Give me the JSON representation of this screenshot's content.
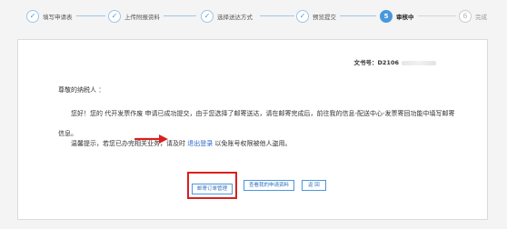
{
  "steps": [
    {
      "num": "✓",
      "label": "填写申请表",
      "state": "done"
    },
    {
      "num": "✓",
      "label": "上传附报资料",
      "state": "done"
    },
    {
      "num": "✓",
      "label": "选择送达方式",
      "state": "done"
    },
    {
      "num": "✓",
      "label": "预览提交",
      "state": "done"
    },
    {
      "num": "5",
      "label": "审核中",
      "state": "active"
    },
    {
      "num": "6",
      "label": "完成",
      "state": "future"
    }
  ],
  "doc_number": {
    "label": "文书号：D2106"
  },
  "message": {
    "greeting": "尊敬的纳税人 ：",
    "body": "您好！您的 代开发票作废 申请已成功提交，由于您选择了邮寄送达，请在邮寄完成后，前往我的信息-配送中心-发票寄回功能中填写邮寄信息。",
    "tip_prefix": "温馨提示，若您已办完相关业务，请及时",
    "tip_link": "退出登录",
    "tip_suffix": "以免账号权限被他人盗用。"
  },
  "buttons": {
    "mail_manage": "邮寄订单管理",
    "view_apply": "查看我的申请资料",
    "back": "返  回"
  },
  "colors": {
    "accent": "#4a97dc",
    "highlight": "#d82020",
    "link": "#2b63c8"
  }
}
